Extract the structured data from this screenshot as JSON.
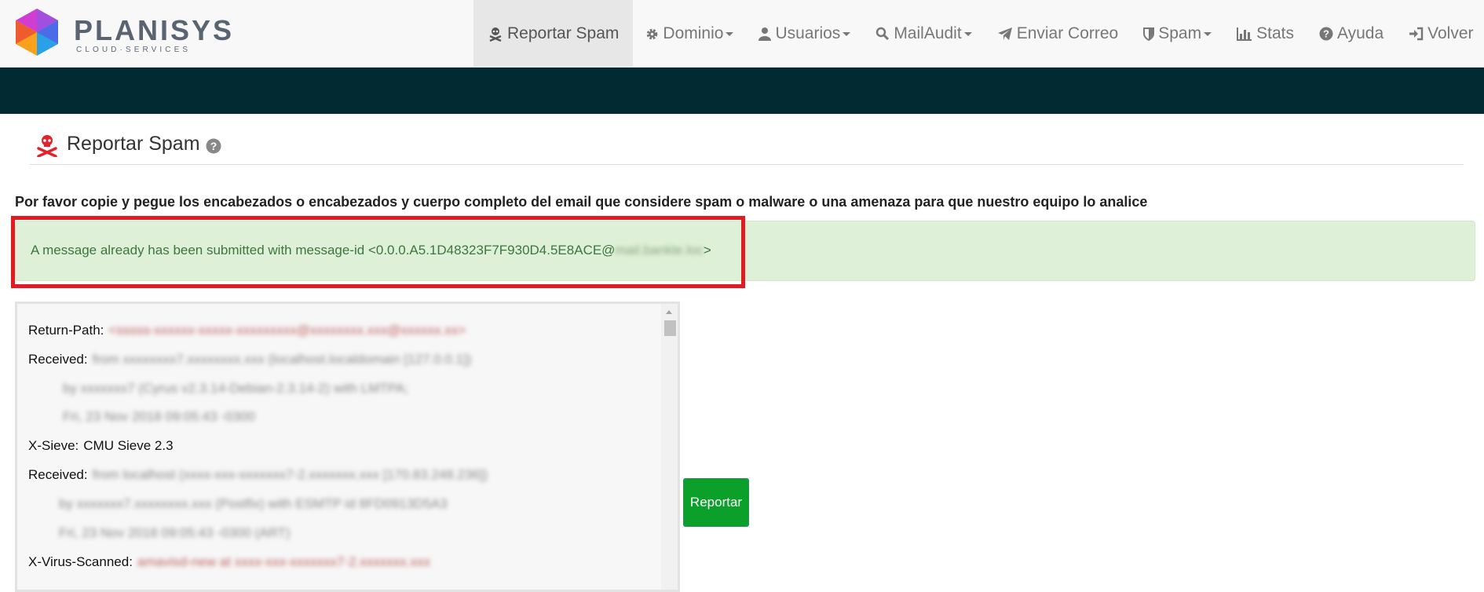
{
  "brand": {
    "name": "PLANISYS",
    "tagline": "CLOUD·SERVICES"
  },
  "nav": [
    {
      "label": "Reportar Spam",
      "icon": "skull-icon",
      "caret": false,
      "active": true
    },
    {
      "label": "Dominio",
      "icon": "gear-icon",
      "caret": true,
      "active": false
    },
    {
      "label": "Usuarios",
      "icon": "user-icon",
      "caret": true,
      "active": false
    },
    {
      "label": "MailAudit",
      "icon": "search-icon",
      "caret": true,
      "active": false
    },
    {
      "label": "Enviar Correo",
      "icon": "send-icon",
      "caret": false,
      "active": false
    },
    {
      "label": "Spam",
      "icon": "shield-icon",
      "caret": true,
      "active": false
    },
    {
      "label": "Stats",
      "icon": "bar-chart-icon",
      "caret": false,
      "active": false
    },
    {
      "label": "Ayuda",
      "icon": "question-circle-icon",
      "caret": false,
      "active": false
    },
    {
      "label": "Volver",
      "icon": "sign-in-icon",
      "caret": false,
      "active": false
    }
  ],
  "page": {
    "title": "Reportar Spam",
    "instructions": "Por favor copie y pegue los encabezados o encabezados y cuerpo completo del email que considere spam o malware o una amenaza para que nuestro equipo lo analice",
    "alert": {
      "prefix": "A message already has been submitted with message-id <0.0.0.A5.1D48323F7F930D4.5E8ACE@",
      "redacted": "mail.bankle.loc",
      "suffix": ">"
    },
    "headers": [
      {
        "key": "Return-Path:",
        "value": "<sssss-xxxxxx-xxxxx-xxxxxxxxx@xxxxxxxx.xxx@xxxxxx.xx>"
      },
      {
        "key": "Received:",
        "value": "from xxxxxxxx7.xxxxxxxx.xxx (localhost.localdomain [127.0.0.1])"
      },
      {
        "key": "",
        "value": "by xxxxxxx7 (Cyrus v2.3.14-Debian-2.3.14-2) with LMTPA;"
      },
      {
        "key": "",
        "value": "Fri, 23 Nov 2018 09:05:43 -0300"
      },
      {
        "key": "X-Sieve:",
        "value": "CMU Sieve 2.3"
      },
      {
        "key": "Received:",
        "value": "from localhost (xxxx-xxx-xxxxxxx7-2.xxxxxxx.xxx [170.83.248.236])"
      },
      {
        "key": "",
        "value": "by xxxxxxx7.xxxxxxxx.xxx (Postfix) with ESMTP id 8FD0913D5A3"
      },
      {
        "key": "",
        "value": "Fri, 23 Nov 2018 09:05:43 -0300 (ART)"
      },
      {
        "key": "X-Virus-Scanned:",
        "value": "amavisd-new at xxxx-xxx-xxxxxxx7-2.xxxxxxx.xxx"
      }
    ],
    "submit_label": "Reportar"
  }
}
